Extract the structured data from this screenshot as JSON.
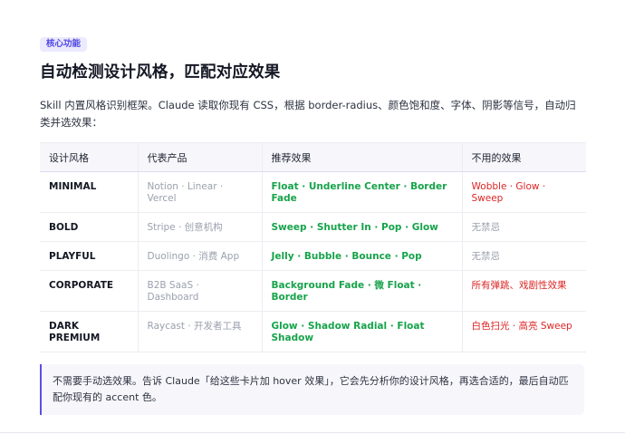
{
  "tag": "核心功能",
  "title": "自动检测设计风格，匹配对应效果",
  "intro": "Skill 内置风格识别框架。Claude 读取你现有 CSS，根据 border-radius、颜色饱和度、字体、阴影等信号，自动归类并选效果：",
  "table": {
    "headers": [
      "设计风格",
      "代表产品",
      "推荐效果",
      "不用的效果"
    ],
    "rows": [
      {
        "style": "MINIMAL",
        "products": "Notion · Linear · Vercel",
        "recommended": "Float · Underline Center · Border Fade",
        "unused": "Wobble · Glow · Sweep",
        "unused_none": false
      },
      {
        "style": "BOLD",
        "products": "Stripe · 创意机构",
        "recommended": "Sweep · Shutter In · Pop · Glow",
        "unused": "无禁忌",
        "unused_none": true
      },
      {
        "style": "PLAYFUL",
        "products": "Duolingo · 消费 App",
        "recommended": "Jelly · Bubble · Bounce · Pop",
        "unused": "无禁忌",
        "unused_none": true
      },
      {
        "style": "CORPORATE",
        "products": "B2B SaaS · Dashboard",
        "recommended": "Background Fade · 微 Float · Border",
        "unused": "所有弹跳、戏剧性效果",
        "unused_none": false
      },
      {
        "style": "DARK PREMIUM",
        "products": "Raycast · 开发者工具",
        "recommended": "Glow · Shadow Radial · Float Shadow",
        "unused": "白色扫光 · 高亮 Sweep",
        "unused_none": false
      }
    ]
  },
  "note": "不需要手动选效果。告诉 Claude「给这些卡片加 hover 效果」，它会先分析你的设计风格，再选合适的，最后自动匹配你现有的 accent 色。",
  "colors": {
    "accent": "#4f46e5",
    "recommended_text": "#16a34a",
    "unused_text": "#dc2626",
    "muted_text": "#9aa0ad",
    "note_border": "#5b4ee6"
  }
}
